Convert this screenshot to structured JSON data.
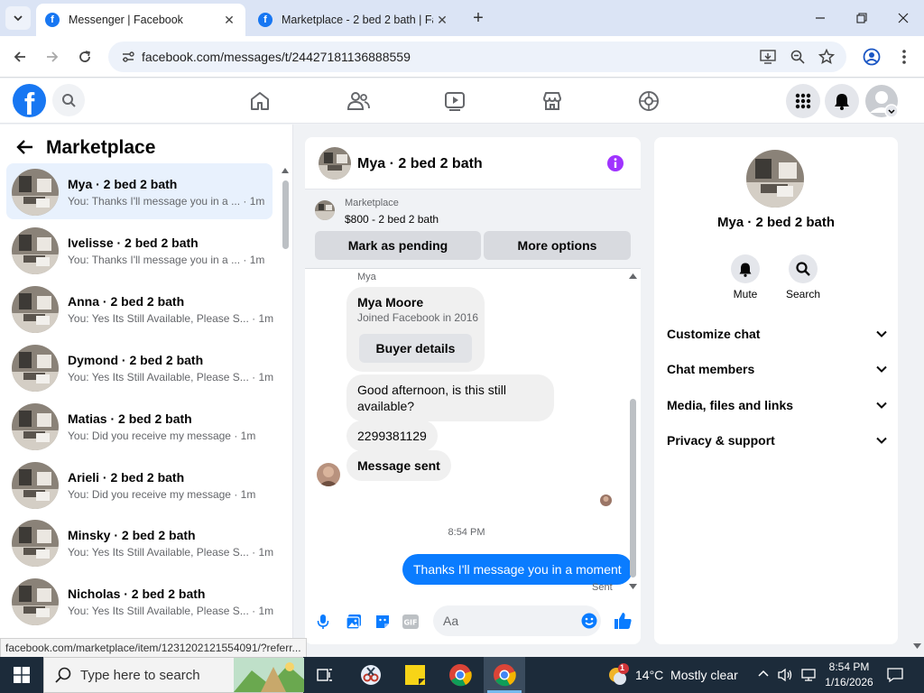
{
  "browser": {
    "tabs": [
      {
        "title": "Messenger | Facebook"
      },
      {
        "title": "Marketplace - 2 bed 2 bath | Fa"
      }
    ],
    "url": "facebook.com/messages/t/24427181136888559",
    "status_url": "facebook.com/marketplace/item/1231202121554091/?referr..."
  },
  "left": {
    "title": "Marketplace",
    "conversations": [
      {
        "name": "Mya · 2 bed 2 bath",
        "preview": "You: Thanks I'll message you in a ...",
        "time": "· 1m"
      },
      {
        "name": "Ivelisse · 2 bed 2 bath",
        "preview": "You: Thanks I'll message you in a ...",
        "time": "· 1m"
      },
      {
        "name": "Anna · 2 bed 2 bath",
        "preview": "You: Yes Its Still Available, Please S...",
        "time": "· 1m"
      },
      {
        "name": "Dymond · 2 bed 2 bath",
        "preview": "You: Yes Its Still Available, Please S...",
        "time": "· 1m"
      },
      {
        "name": "Matias · 2 bed 2 bath",
        "preview": "You: Did you receive my message",
        "time": "· 1m"
      },
      {
        "name": "Arieli · 2 bed 2 bath",
        "preview": "You: Did you receive my message",
        "time": "· 1m"
      },
      {
        "name": "Minsky · 2 bed 2 bath",
        "preview": "You: Yes Its Still Available, Please S...",
        "time": "· 1m"
      },
      {
        "name": "Nicholas · 2 bed 2 bath",
        "preview": "You: Yes Its Still Available, Please S...",
        "time": "· 1m"
      }
    ]
  },
  "chat": {
    "title": "Mya · 2 bed 2 bath",
    "marketplace_label": "Marketplace",
    "listing": "$800 - 2 bed 2 bath",
    "mark_pending": "Mark as pending",
    "more_options": "More options",
    "sender_label": "Mya",
    "profile_name": "Mya Moore",
    "profile_joined": "Joined Facebook in 2016",
    "buyer_details": "Buyer details",
    "messages": [
      "Good afternoon, is this still available?",
      "2299381129",
      "Message sent"
    ],
    "timestamp": "8:54 PM",
    "my_message": "Thanks I'll message you in a moment",
    "sent_label": "Sent",
    "composer_placeholder": "Aa"
  },
  "right": {
    "name": "Mya · 2 bed 2 bath",
    "mute": "Mute",
    "search": "Search",
    "sections": [
      "Customize chat",
      "Chat members",
      "Media, files and links",
      "Privacy & support"
    ]
  },
  "taskbar": {
    "search_placeholder": "Type here to search",
    "weather": "14°C  Mostly clear",
    "time": "8:54 PM",
    "date": "1/16/2026",
    "notification_count": "1"
  },
  "colors": {
    "accent": "#1877f2",
    "bubble_me": "#0a7cff",
    "info_purple": "#a033ff"
  }
}
